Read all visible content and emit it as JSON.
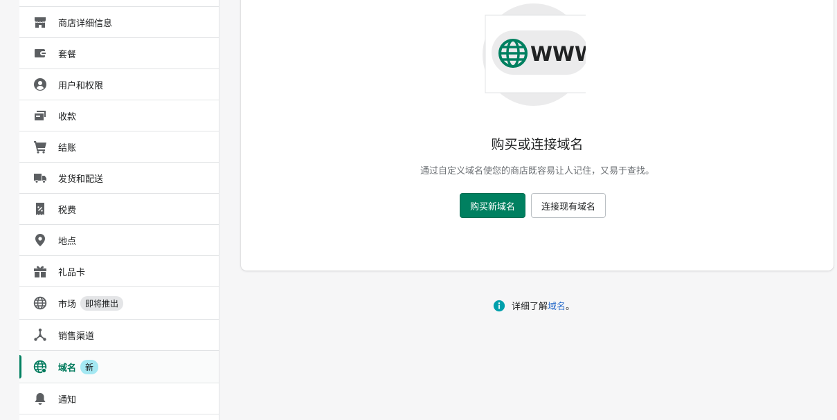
{
  "sidebar": {
    "items": [
      {
        "label": "商店详细信息",
        "icon": "store-icon"
      },
      {
        "label": "套餐",
        "icon": "wallet-icon"
      },
      {
        "label": "用户和权限",
        "icon": "user-circle-icon"
      },
      {
        "label": "收款",
        "icon": "payment-card-icon"
      },
      {
        "label": "结账",
        "icon": "cart-icon"
      },
      {
        "label": "发货和配送",
        "icon": "truck-icon"
      },
      {
        "label": "税费",
        "icon": "receipt-icon"
      },
      {
        "label": "地点",
        "icon": "location-pin-icon"
      },
      {
        "label": "礼品卡",
        "icon": "gift-icon"
      },
      {
        "label": "市场",
        "icon": "globe-icon",
        "badge": "即将推出"
      },
      {
        "label": "销售渠道",
        "icon": "channels-icon"
      },
      {
        "label": "域名",
        "icon": "domain-globe-icon",
        "badge": "新",
        "active": true
      },
      {
        "label": "通知",
        "icon": "bell-icon"
      }
    ]
  },
  "main": {
    "illustration_text": "WWW",
    "headline": "购买或连接域名",
    "subtext": "通过自定义域名使您的商店既容易让人记住，又易于查找。",
    "buy_button": "购买新域名",
    "connect_button": "连接现有域名",
    "learn_more_prefix": "详细了解",
    "learn_more_link": "域名",
    "learn_more_suffix": "。"
  },
  "colors": {
    "accent": "#008060",
    "link": "#2c6ecb",
    "info": "#00a0ac"
  }
}
